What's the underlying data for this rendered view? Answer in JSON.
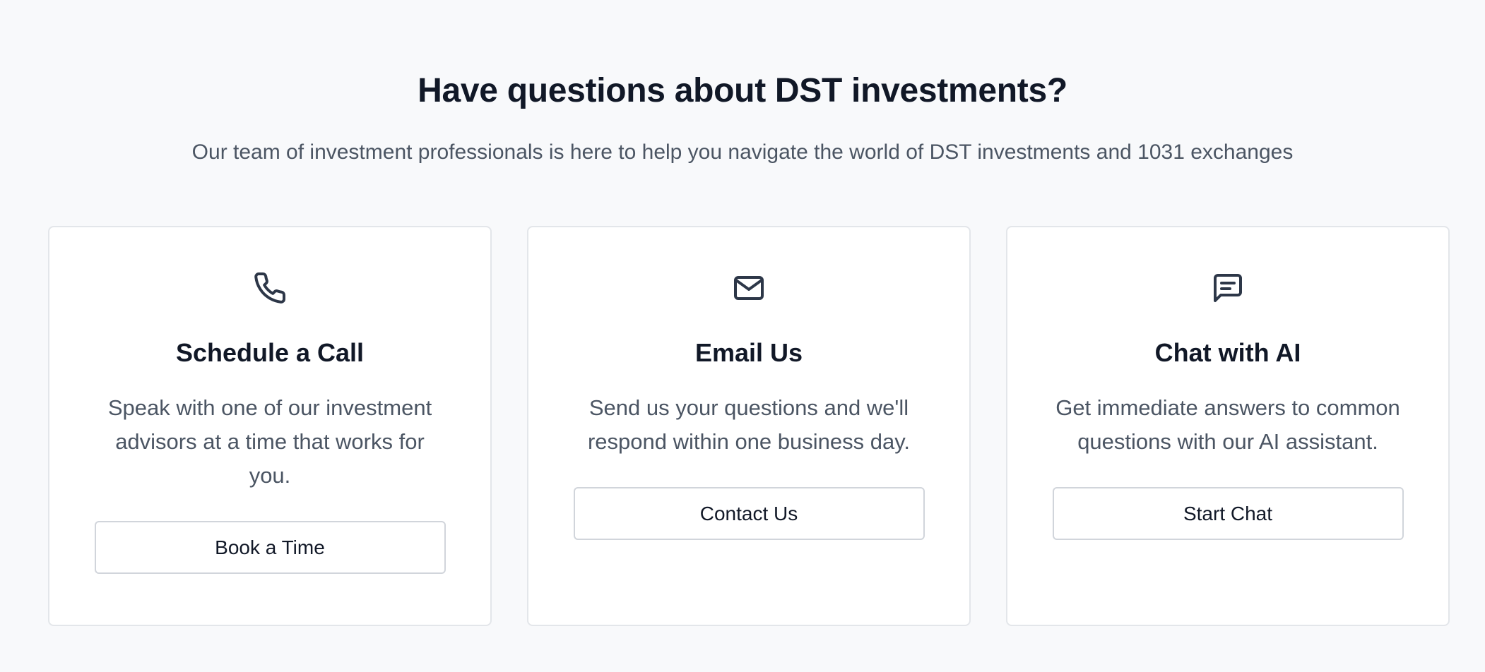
{
  "header": {
    "title": "Have questions about DST investments?",
    "subtitle": "Our team of investment professionals is here to help you navigate the world of DST investments and 1031 exchanges"
  },
  "cards": [
    {
      "icon": "phone-icon",
      "title": "Schedule a Call",
      "description": "Speak with one of our investment advisors at a time that works for you.",
      "button_label": "Book a Time"
    },
    {
      "icon": "mail-icon",
      "title": "Email Us",
      "description": "Send us your questions and we'll respond within one business day.",
      "button_label": "Contact Us"
    },
    {
      "icon": "message-square-icon",
      "title": "Chat with AI",
      "description": "Get immediate answers to common questions with our AI assistant.",
      "button_label": "Start Chat"
    }
  ],
  "colors": {
    "background": "#f8f9fb",
    "card_background": "#ffffff",
    "heading": "#111827",
    "body_text": "#4b5563",
    "icon_stroke": "#2d3748",
    "border": "#e3e6ea"
  }
}
